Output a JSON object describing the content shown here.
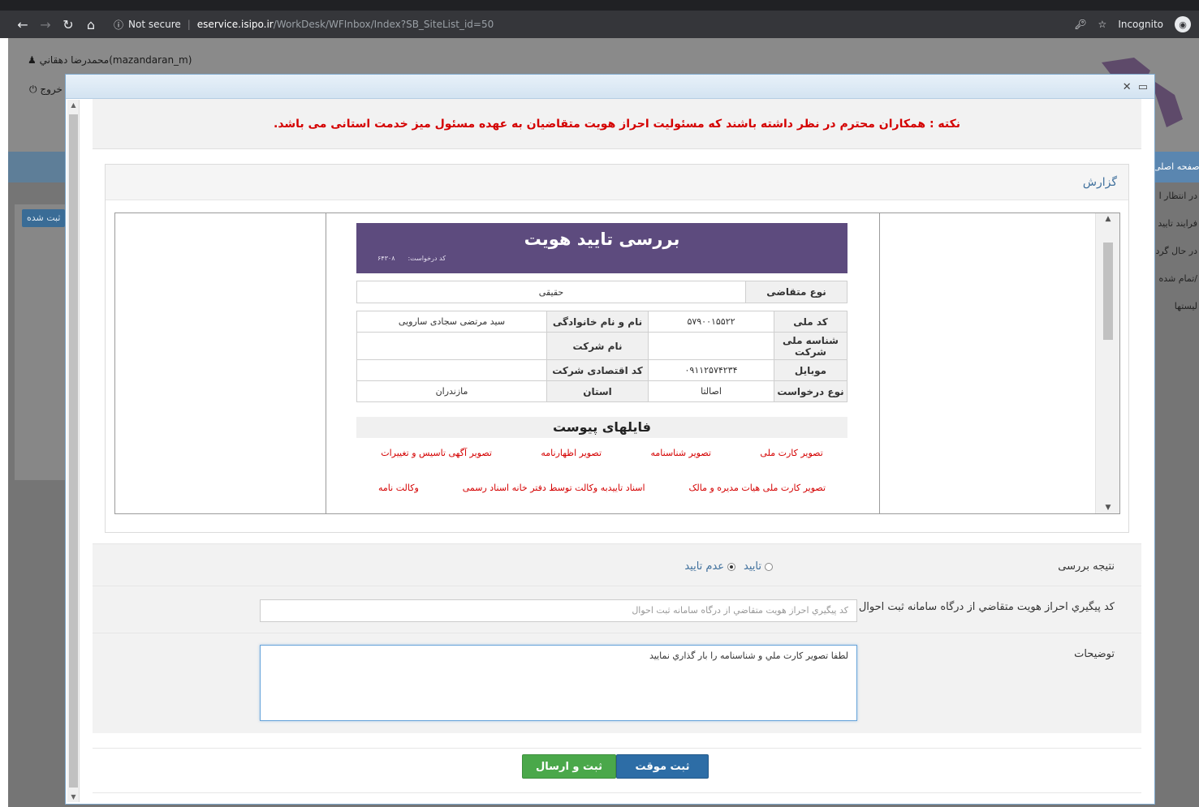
{
  "browser": {
    "security": "Not secure",
    "url_host": "eservice.isipo.ir",
    "url_path": "/WorkDesk/WFInbox/Index?SB_SiteList_id=50",
    "mode": "Incognito"
  },
  "header": {
    "user": "محمدرضا دهقاني(mazandaran_m)",
    "logout": "خروج"
  },
  "background": {
    "left_tab": "ثبت شده",
    "right_menu": [
      "صفحه اصلی",
      "در انتظار ا",
      "فرایند تایید",
      "در حال گرد",
      "تمام شده/",
      "لیستها"
    ]
  },
  "modal": {
    "notice": "نکته : همکاران محترم در نظر داشته باشند که مسئولیت احراز هویت متقاضیان به عهده مسئول میز خدمت استانی می باشد.",
    "report_title": "گزارش",
    "doc": {
      "title": "بررسی تایید هویت",
      "request_label": "کد درخواست:",
      "request_no": "۶۴۳۰۸",
      "applicant_type_label": "نوع متقاضی",
      "applicant_type": "حقیقی",
      "national_code_label": "کد ملی",
      "national_code": "۵۷۹۰۰۱۵۵۲۲",
      "fullname_label": "نام و نام خانوادگی",
      "fullname": "سید مرتضی سجادی سارویی",
      "company_id_label": "شناسه ملی شرکت",
      "company_id": "",
      "company_name_label": "نام شرکت",
      "company_name": "",
      "mobile_label": "موبایل",
      "mobile": "۰۹۱۱۲۵۷۴۲۳۴",
      "econ_code_label": "کد اقتصادی شرکت",
      "econ_code": "",
      "request_type_label": "نوع درخواست",
      "request_type": "اصالتا",
      "province_label": "استان",
      "province": "مازندران",
      "files_title": "فایلهای پیوست",
      "files_row1": [
        "تصویر کارت ملی",
        "تصویر شناسنامه",
        "تصویر اظهارنامه",
        "تصویر آگهی تاسیس و تغییرات"
      ],
      "files_row2": [
        "تصویر کارت ملی هیات مدیره و مالک",
        "اسناد تاییدبه وکالت توسط دفتر خانه اسناد رسمی",
        "وکالت نامه"
      ]
    },
    "form": {
      "result_label": "نتیجه بررسی",
      "approve": "تایید",
      "reject": "عدم تایید",
      "tracking_label": "کد پيگيري احراز هويت متقاضي از درگاه سامانه ثبت احوال",
      "tracking_placeholder": "کد پيگيري احراز هويت متقاضي از درگاه سامانه ثبت احوال",
      "notes_label": "توضيحات",
      "notes_value": "لطفا تصوير کارت ملي و شناسنامه را بار گذاري نماييد"
    },
    "buttons": {
      "temp_save": "ثبت موقت",
      "submit": "ثبت و ارسال"
    }
  }
}
